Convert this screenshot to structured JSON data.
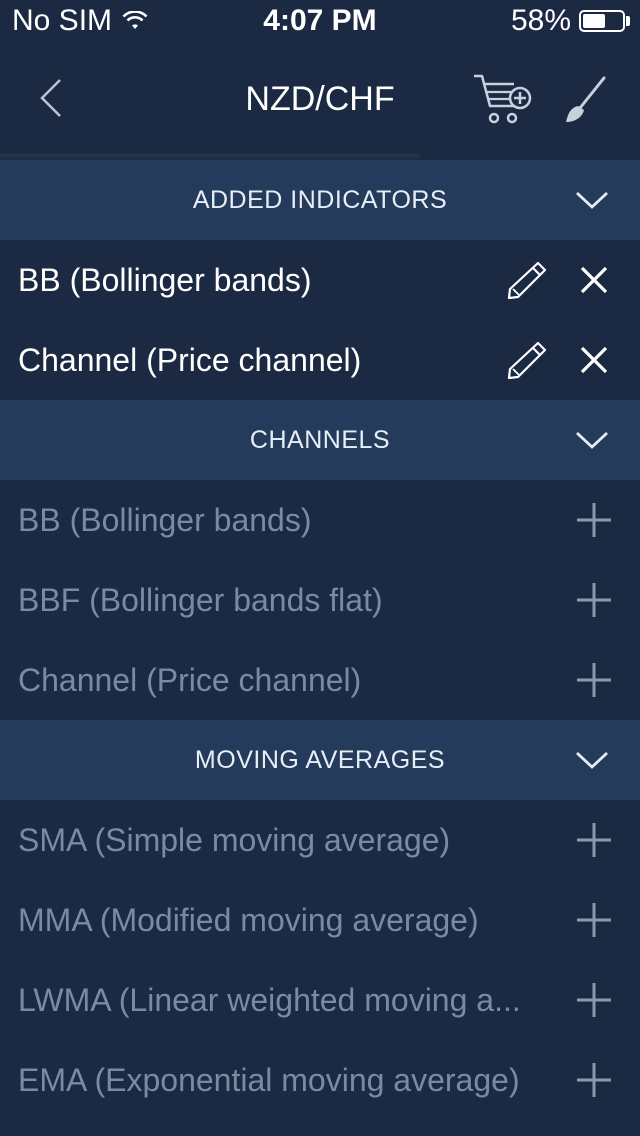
{
  "status_bar": {
    "carrier": "No SIM",
    "time": "4:07 PM",
    "battery": "58%",
    "battery_level": 0.58
  },
  "nav": {
    "title": "NZD/CHF",
    "icons": [
      "back-chevron-icon",
      "cart-add-icon",
      "paintbrush-icon"
    ]
  },
  "sections": {
    "added": {
      "title": "ADDED INDICATORS",
      "items": [
        "BB (Bollinger bands)",
        "Channel (Price channel)"
      ]
    },
    "channels": {
      "title": "CHANNELS",
      "items": [
        "BB (Bollinger bands)",
        "BBF (Bollinger bands flat)",
        "Channel (Price channel)"
      ]
    },
    "moving_averages": {
      "title": "MOVING AVERAGES",
      "items": [
        "SMA (Simple moving average)",
        "MMA (Modified moving average)",
        "LWMA (Linear weighted moving a...",
        "EMA (Exponential moving average)"
      ]
    }
  },
  "colors": {
    "background": "#1b2a42",
    "section_header": "#243b5c",
    "inactive_text": "#7a8aa3",
    "icon_muted": "#8c9ab0"
  }
}
